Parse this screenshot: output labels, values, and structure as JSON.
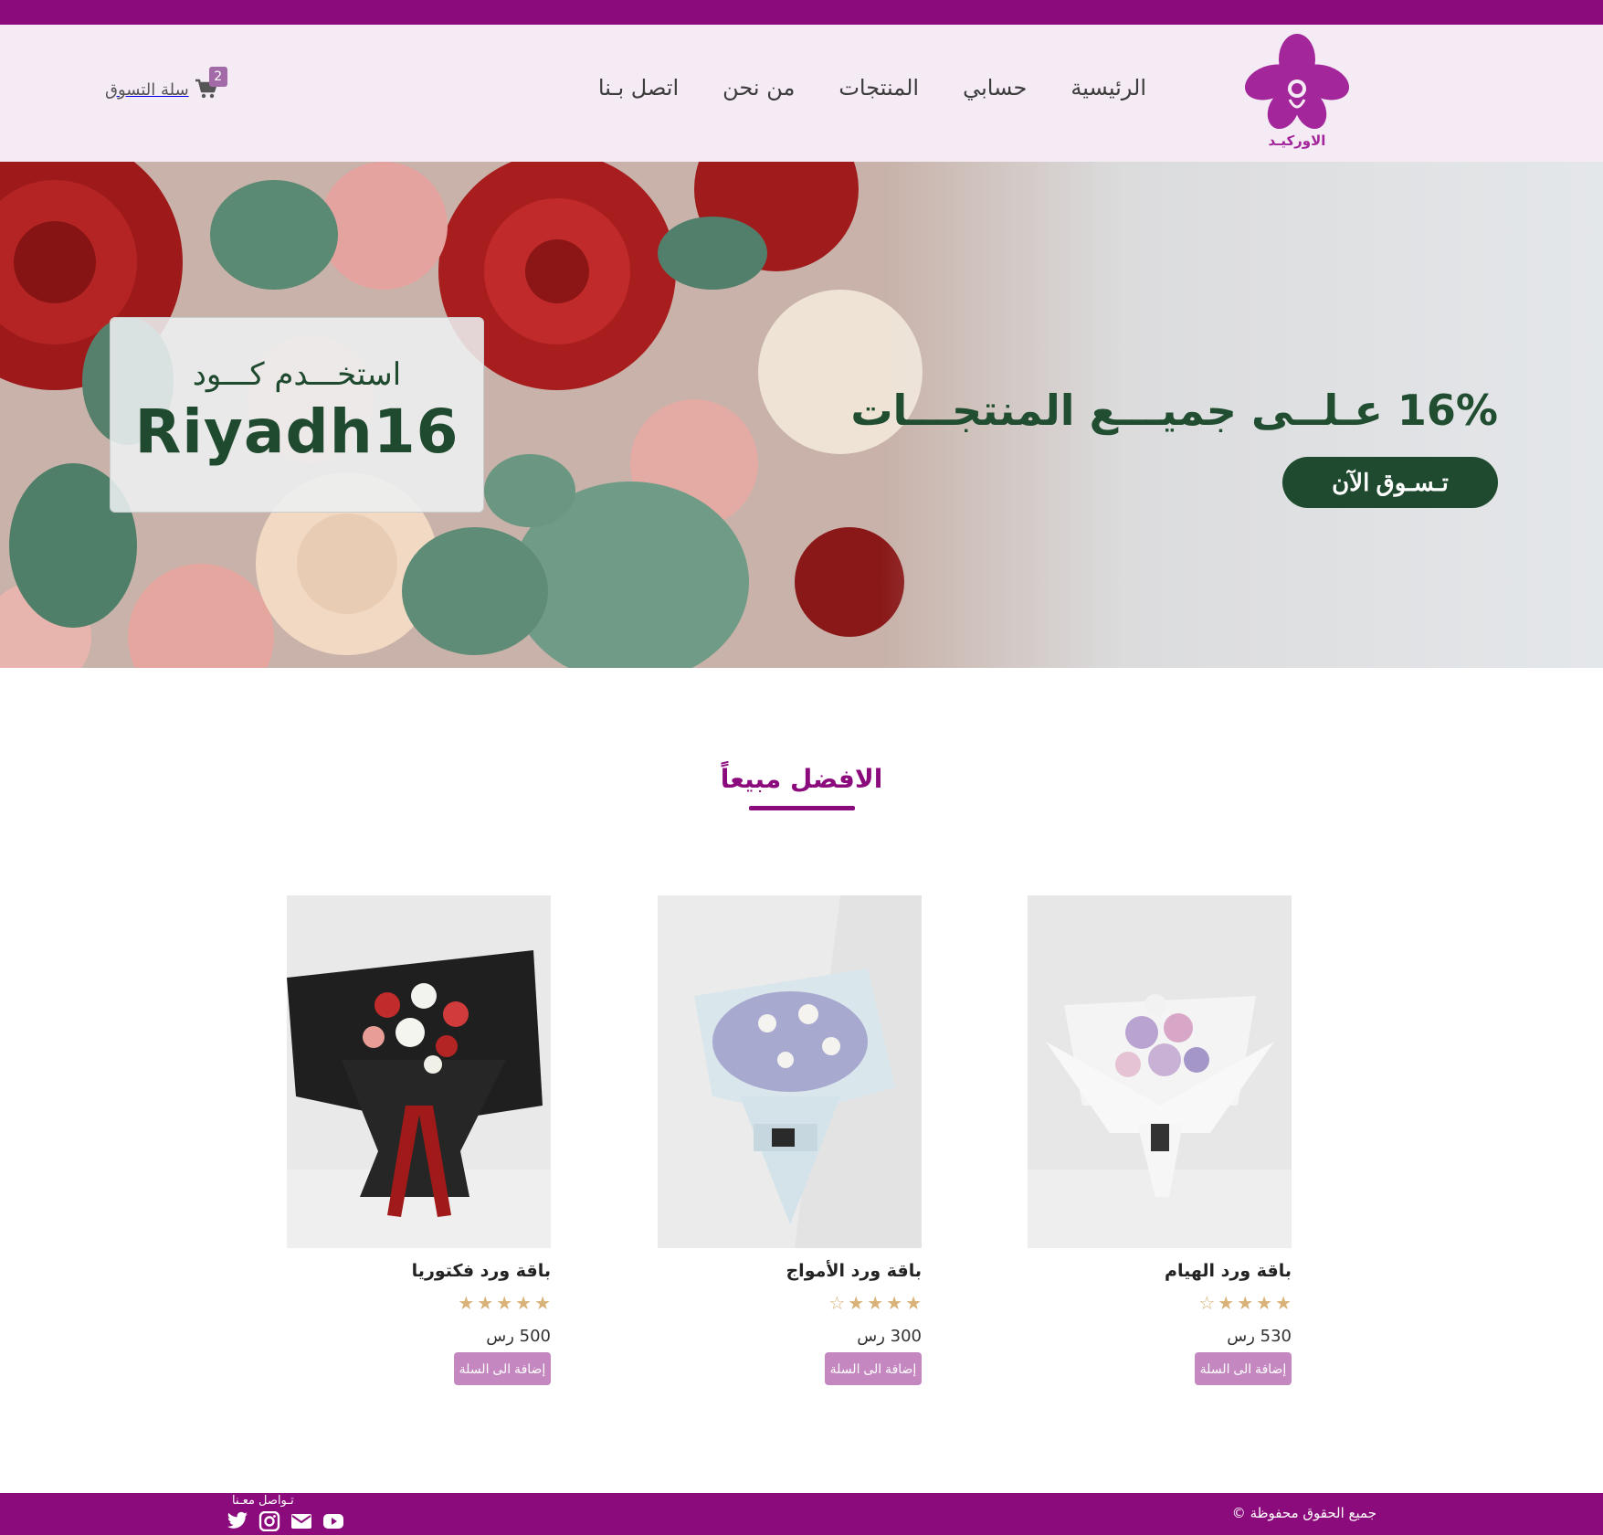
{
  "brand": {
    "logo_text": "الاوركيـد",
    "primary_color": "#8b0a7c",
    "accent_color": "#1f4a2f"
  },
  "nav": {
    "items": [
      {
        "label": "الرئيسية"
      },
      {
        "label": "حسابي"
      },
      {
        "label": "المنتجات"
      },
      {
        "label": "من نحن"
      },
      {
        "label": "اتصل بـنا"
      }
    ]
  },
  "cart": {
    "label": "سلة التسوق",
    "count": "2",
    "icon": "cart-icon"
  },
  "hero": {
    "coupon_title": "استخـــدم كـــود",
    "coupon_code": "Riyadh16",
    "headline": "16% عـلــى جميـــع المنتجـــات",
    "cta_label": "تـسـوق الآن"
  },
  "bestsellers": {
    "title": "الافضل مبيعاً",
    "products": [
      {
        "name": "باقة ورد الهيام",
        "rating": 4,
        "price": "530 رس",
        "button": "إضافة الى السلة"
      },
      {
        "name": "باقة ورد الأمواج",
        "rating": 4,
        "price": "300 رس",
        "button": "إضافة الى السلة"
      },
      {
        "name": "باقة ورد فكتوريا",
        "rating": 5,
        "price": "500 رس",
        "button": "إضافة الى السلة"
      }
    ]
  },
  "footer": {
    "rights": "جميع الحقوق محفوظة ©",
    "social_label": "تـواصل معـنا",
    "social_icons": [
      "twitter-icon",
      "instagram-icon",
      "email-icon",
      "youtube-icon"
    ]
  }
}
